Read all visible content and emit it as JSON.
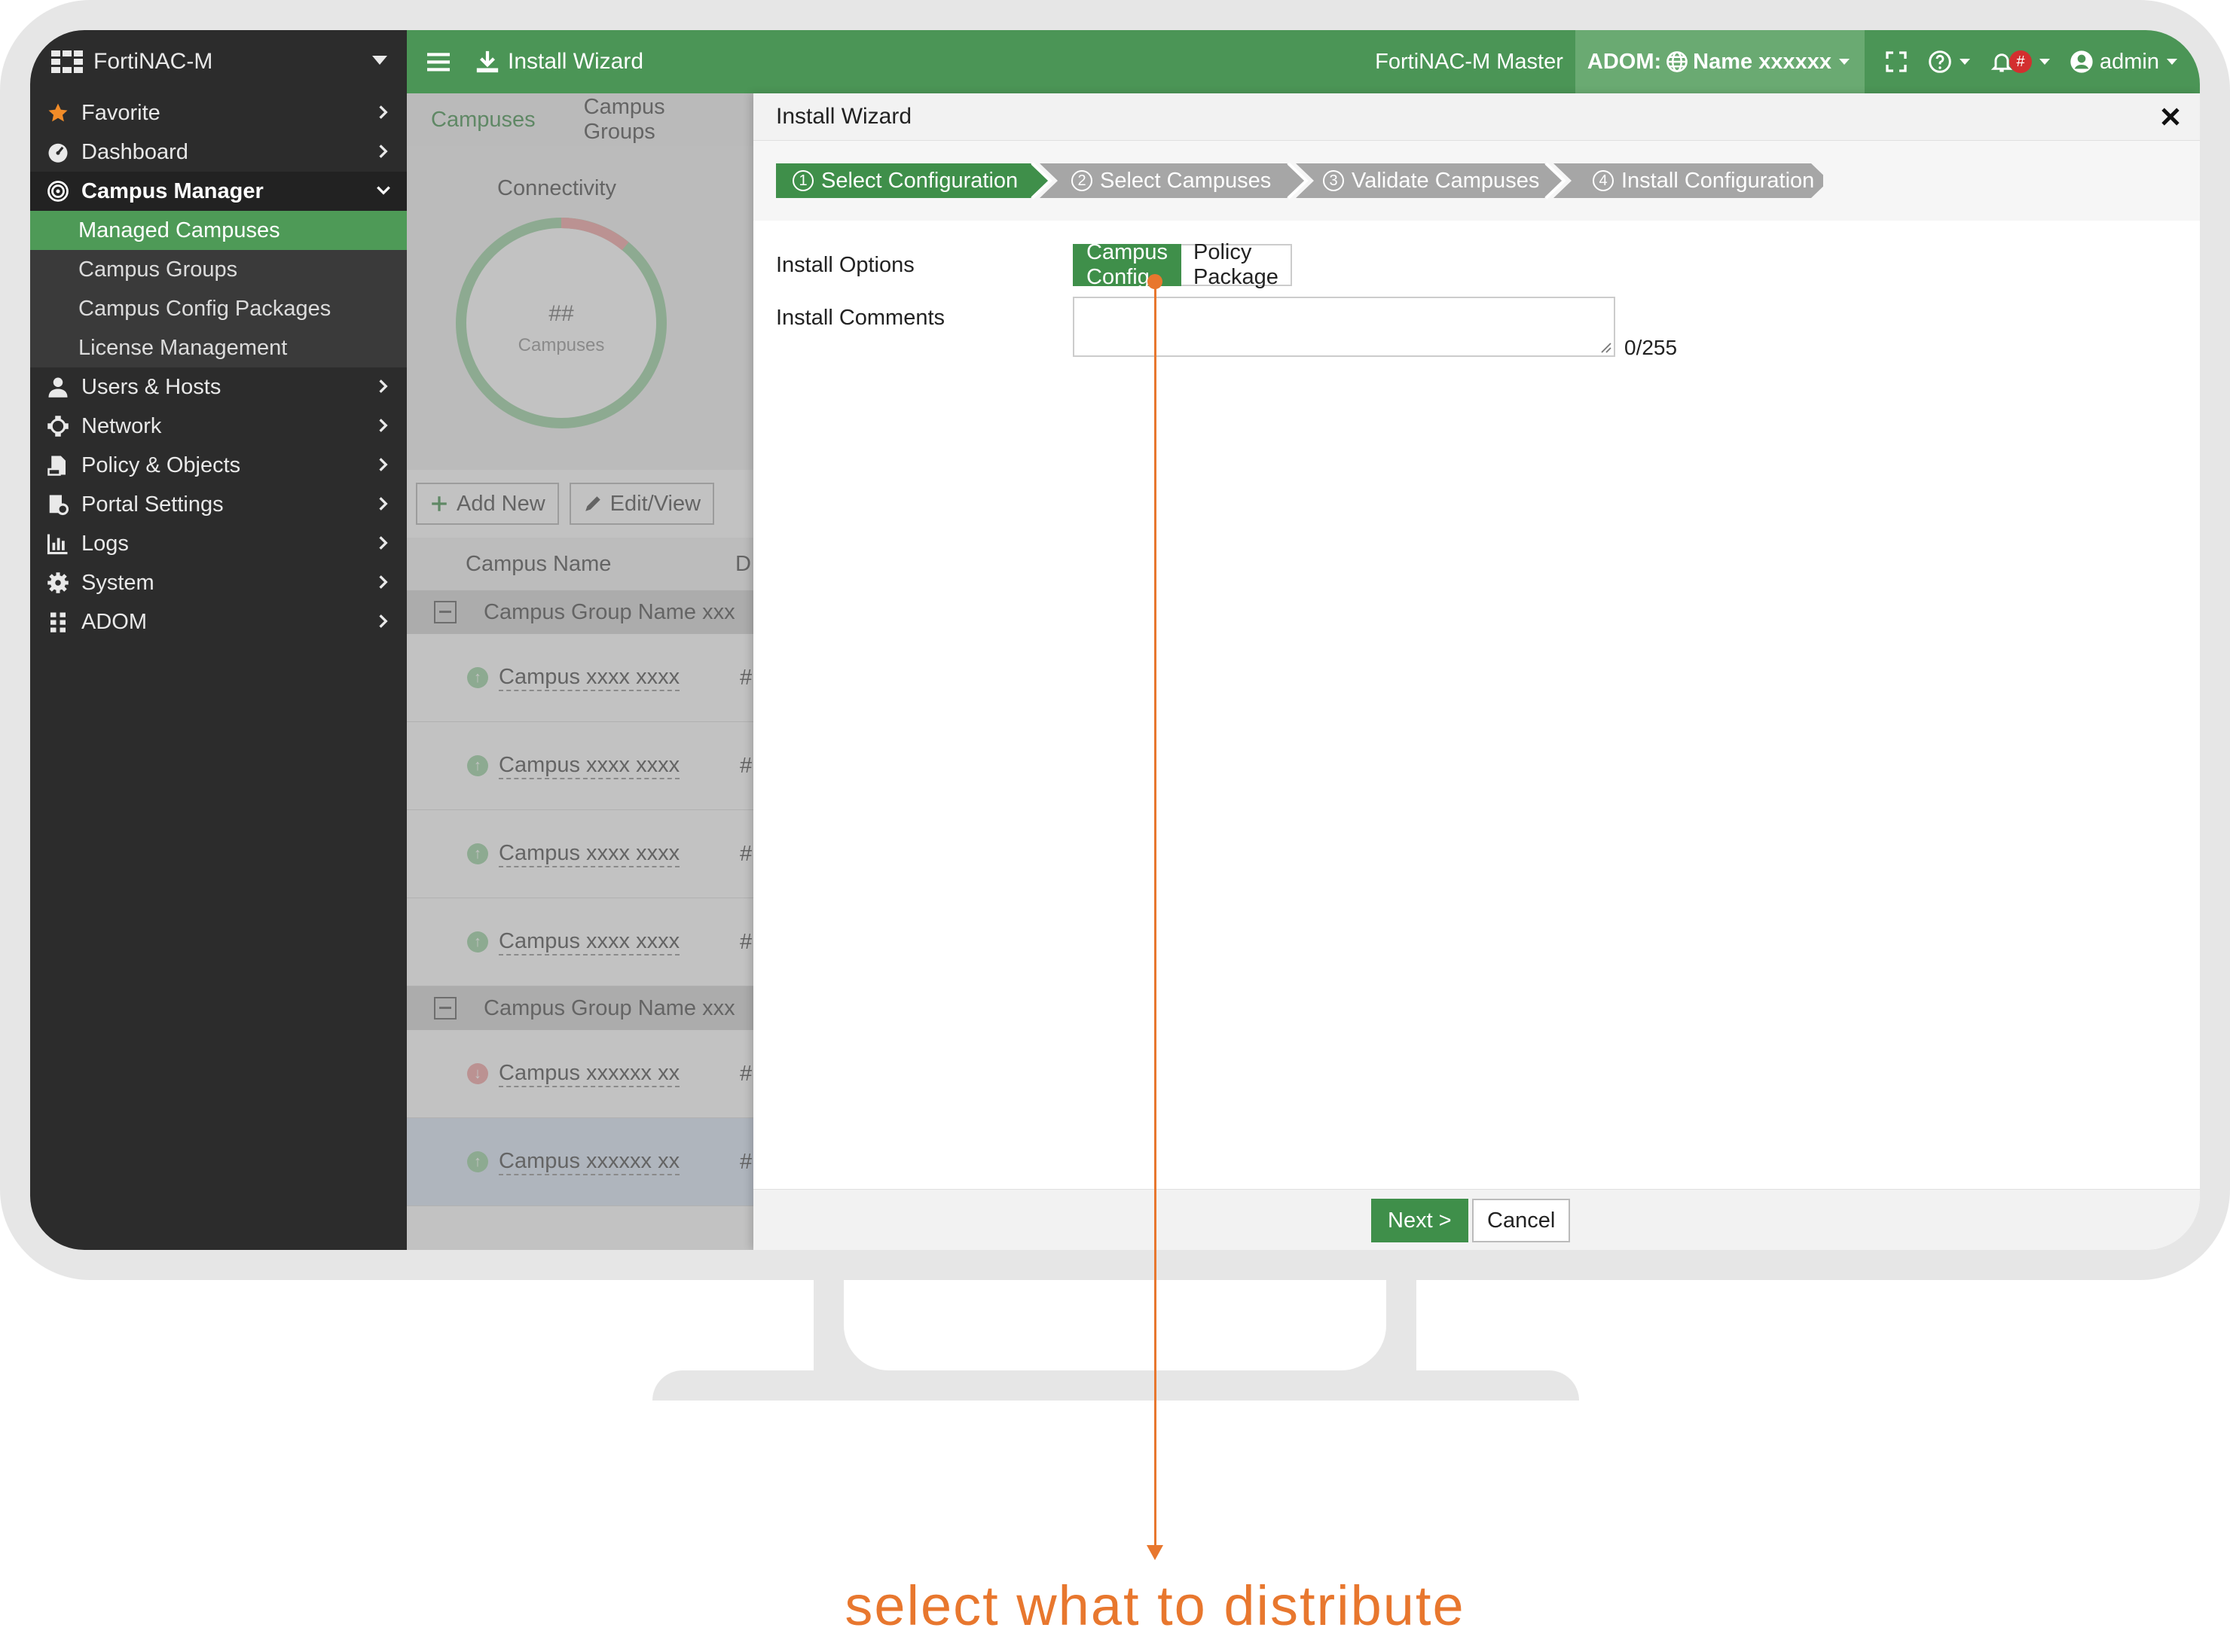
{
  "app": {
    "brand": "FortiNAC-M",
    "device_name": "FortiNAC-M Master",
    "adom_label": "ADOM:",
    "adom_value": "Name xxxxxx",
    "user": "admin",
    "notification_badge": "#",
    "accent_color": "#4b9556"
  },
  "sidebar": {
    "items": [
      {
        "label": "Favorite",
        "icon": "star-icon"
      },
      {
        "label": "Dashboard",
        "icon": "dashboard-icon"
      },
      {
        "label": "Campus Manager",
        "icon": "campus-icon",
        "expanded": true
      },
      {
        "label": "Users & Hosts",
        "icon": "user-icon"
      },
      {
        "label": "Network",
        "icon": "network-icon"
      },
      {
        "label": "Policy & Objects",
        "icon": "policy-icon"
      },
      {
        "label": "Portal Settings",
        "icon": "portal-icon"
      },
      {
        "label": "Logs",
        "icon": "logs-icon"
      },
      {
        "label": "System",
        "icon": "gear-icon"
      },
      {
        "label": "ADOM",
        "icon": "adom-icon"
      }
    ],
    "subitems": [
      {
        "label": "Managed Campuses",
        "selected": true
      },
      {
        "label": "Campus Groups"
      },
      {
        "label": "Campus Config Packages"
      },
      {
        "label": "License Management"
      }
    ]
  },
  "topbar": {
    "title": "Install Wizard"
  },
  "background_page": {
    "tabs": [
      "Campuses",
      "Campus Groups"
    ],
    "widget_title": "Connectivity",
    "widget_value": "##",
    "widget_caption": "Campuses",
    "add_new": "Add New",
    "edit_view": "Edit/View",
    "column_header": "Campus Name",
    "column_header_2": "D",
    "groups": [
      {
        "name": "Campus Group Name xxx",
        "campuses": [
          "Campus xxxx xxxx",
          "Campus xxxx xxxx",
          "Campus xxxx xxxx",
          "Campus xxxx xxxx"
        ]
      },
      {
        "name": "Campus Group Name xxx",
        "campuses": [
          "Campus xxxxxx xx",
          "Campus xxxxxx xx"
        ]
      }
    ],
    "row_hash": "#"
  },
  "wizard": {
    "title": "Install Wizard",
    "steps": [
      {
        "num": "1",
        "label": "Select Configuration",
        "active": true
      },
      {
        "num": "2",
        "label": "Select Campuses"
      },
      {
        "num": "3",
        "label": "Validate Campuses"
      },
      {
        "num": "4",
        "label": "Install Configuration"
      }
    ],
    "install_options_label": "Install Options",
    "options": [
      "Campus Config",
      "Policy Package"
    ],
    "selected_option": "Campus Config",
    "install_comments_label": "Install Comments",
    "comments_value": "",
    "counter": "0/255",
    "next_label": "Next >",
    "cancel_label": "Cancel"
  },
  "annotation": {
    "text": "select what to distribute",
    "color": "#e8772e"
  }
}
